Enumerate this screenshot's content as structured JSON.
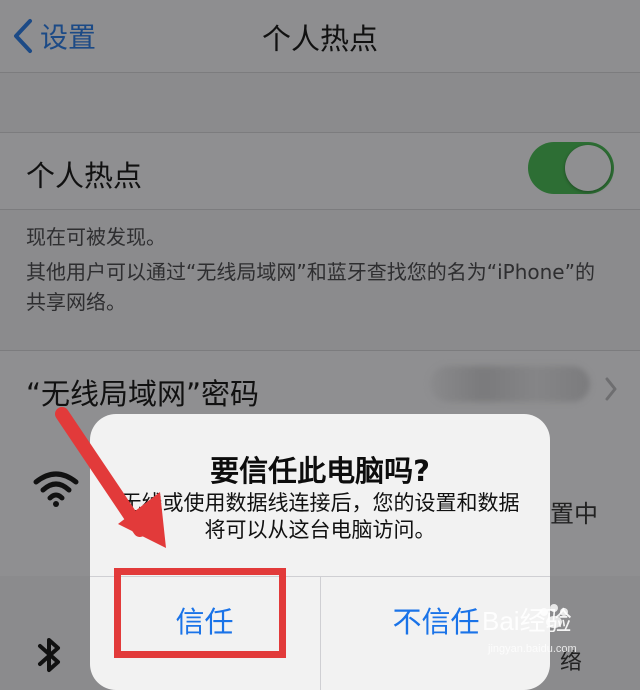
{
  "nav": {
    "back_label": "设置",
    "title": "个人热点"
  },
  "hotspot_row": {
    "label": "个人热点",
    "toggle_on": true
  },
  "footer": {
    "line1": "现在可被发现。",
    "line2": "其他用户可以通过“无线局域网”和蓝牙查找您的名为“iPhone”的共享网络。"
  },
  "password_row": {
    "label": "“无线局域网”密码"
  },
  "background_snippets": {
    "wifi_side_text": "置中",
    "bottom_side_text": "络"
  },
  "alert": {
    "title": "要信任此电脑吗?",
    "message": "无线或使用数据线连接后，您的设置和数据将可以从这台电脑访问。",
    "trust_label": "信任",
    "distrust_label": "不信任"
  },
  "watermark": {
    "text": "Bai经验"
  },
  "colors": {
    "toggle_on": "#2d6e34",
    "alert_button": "#1a73e8",
    "annotation": "#e23a3a"
  },
  "icons": {
    "back": "chevron-left-icon",
    "wifi": "wifi-icon",
    "bluetooth": "bluetooth-icon",
    "chevron": "chevron-right-icon"
  }
}
